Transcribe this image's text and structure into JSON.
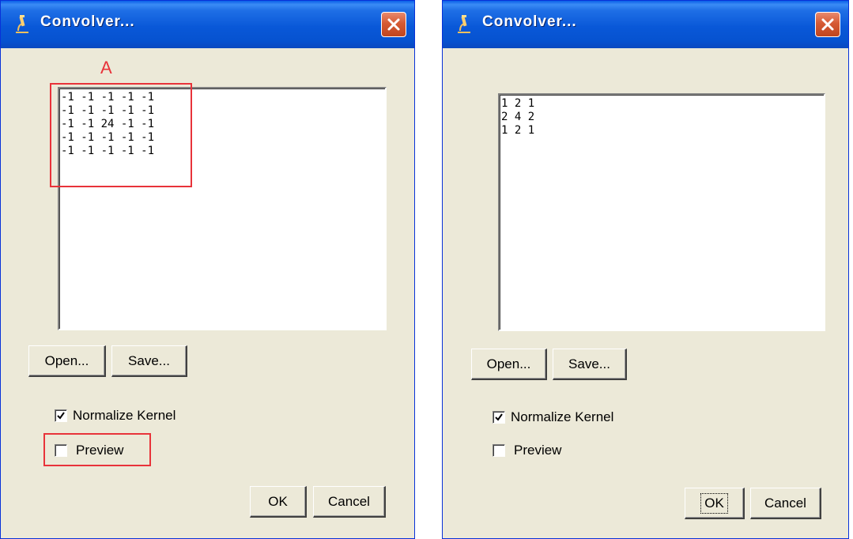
{
  "dialogs": [
    {
      "title": "Convolver...",
      "kernel_text": "-1 -1 -1 -1 -1\n-1 -1 -1 -1 -1\n-1 -1 24 -1 -1\n-1 -1 -1 -1 -1\n-1 -1 -1 -1 -1",
      "open_label": "Open...",
      "save_label": "Save...",
      "normalize_label": "Normalize Kernel",
      "normalize_checked": true,
      "preview_label": "Preview",
      "preview_checked": false,
      "ok_label": "OK",
      "cancel_label": "Cancel",
      "annotation_label": "A",
      "annotation_color": "#e8333a"
    },
    {
      "title": "Convolver...",
      "kernel_text": "1 2 1\n2 4 2\n1 2 1",
      "open_label": "Open...",
      "save_label": "Save...",
      "normalize_label": "Normalize Kernel",
      "normalize_checked": true,
      "preview_label": "Preview",
      "preview_checked": false,
      "ok_label": "OK",
      "cancel_label": "Cancel"
    }
  ],
  "icons": {
    "app": "microscope-icon",
    "close": "close-icon",
    "check": "checkmark-icon"
  },
  "colors": {
    "titlebar": "#0958d8",
    "dialog_bg": "#ece9d8",
    "close_button": "#d65a34"
  }
}
